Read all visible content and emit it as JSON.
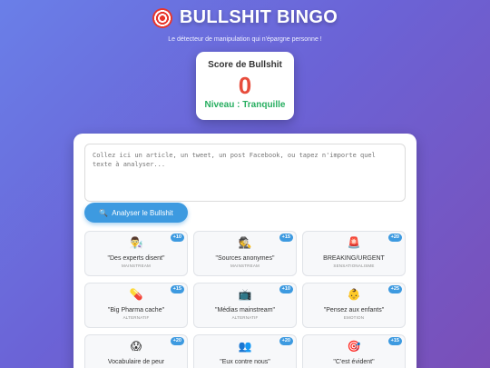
{
  "header": {
    "title": "BULLSHIT BINGO",
    "subtitle": "Le détecteur de manipulation qui n'épargne personne !"
  },
  "score": {
    "title": "Score de Bullshit",
    "value": "0",
    "level": "Niveau : Tranquille"
  },
  "input": {
    "placeholder": "Collez ici un article, un tweet, un post Facebook, ou tapez n'importe quel texte à analyser..."
  },
  "analyze_button": {
    "icon": "🔍",
    "label": "Analyser le Bullshit"
  },
  "cards": [
    {
      "emoji": "👨‍🔬",
      "label": "\"Des experts disent\"",
      "category": "MAINSTREAM",
      "points": "+10"
    },
    {
      "emoji": "🕵️",
      "label": "\"Sources anonymes\"",
      "category": "MAINSTREAM",
      "points": "+15"
    },
    {
      "emoji": "🚨",
      "label": "BREAKING/URGENT",
      "category": "SENSATIONALISME",
      "points": "+20"
    },
    {
      "emoji": "💊",
      "label": "\"Big Pharma cache\"",
      "category": "ALTERNATIF",
      "points": "+15"
    },
    {
      "emoji": "📺",
      "label": "\"Médias mainstream\"",
      "category": "ALTERNATIF",
      "points": "+10"
    },
    {
      "emoji": "👶",
      "label": "\"Pensez aux enfants\"",
      "category": "EMOTION",
      "points": "+25"
    },
    {
      "emoji": "😱",
      "label": "Vocabulaire de peur",
      "category": "",
      "points": "+20"
    },
    {
      "emoji": "👥",
      "label": "\"Eux contre nous\"",
      "category": "",
      "points": "+20"
    },
    {
      "emoji": "🎯",
      "label": "\"C'est évident\"",
      "category": "",
      "points": "+15"
    }
  ],
  "colors": {
    "accent": "#3d9ae0",
    "score_value": "#e74c3c",
    "level": "#27ae60"
  }
}
